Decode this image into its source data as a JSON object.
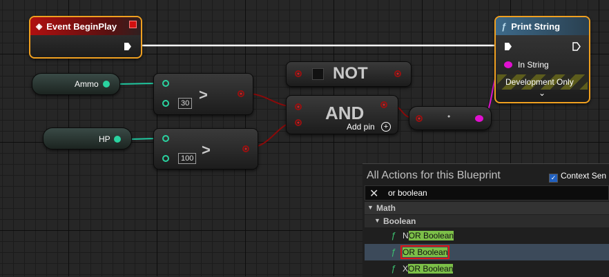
{
  "nodes": {
    "event": {
      "title": "Event BeginPlay"
    },
    "print": {
      "title": "Print String",
      "in_string": "In String",
      "dev_only": "Development Only"
    },
    "ammo": {
      "label": "Ammo"
    },
    "hp": {
      "label": "HP"
    },
    "cmp1": {
      "op": ">",
      "value": "30"
    },
    "cmp2": {
      "op": ">",
      "value": "100"
    },
    "not_node": {
      "title": "NOT"
    },
    "and_node": {
      "title": "AND",
      "add_pin": "Add pin"
    },
    "reroute": {
      "dot": "•"
    }
  },
  "panel": {
    "title": "All Actions for this Blueprint",
    "context": "Context Sen",
    "search_value": "or boolean",
    "categories": [
      "Math",
      "Boolean"
    ],
    "items": [
      {
        "prefix": "N",
        "match": "OR Boolean"
      },
      {
        "prefix": "",
        "match": "OR Boolean"
      },
      {
        "prefix": "X",
        "match": "OR Boolean"
      }
    ]
  },
  "colors": {
    "exec_wire": "#ffffff",
    "bool_wire": "#8a0a0a",
    "int_wire": "#20c8a0",
    "selection": "#f0a020",
    "highlight": "#7cbf48"
  }
}
